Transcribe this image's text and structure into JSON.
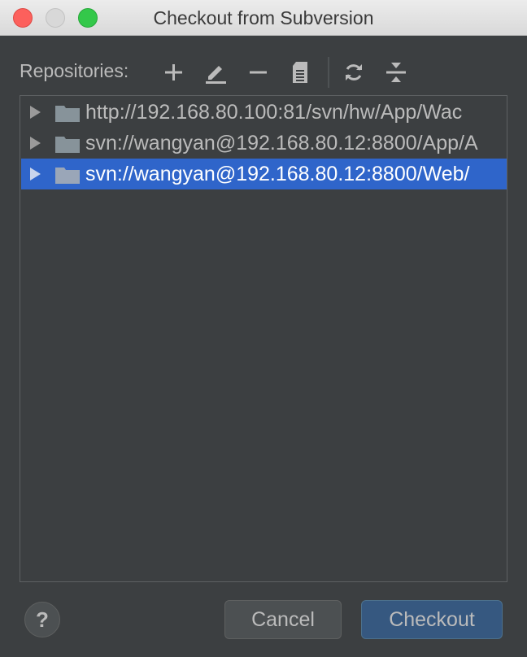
{
  "window": {
    "title": "Checkout from Subversion"
  },
  "toolbar": {
    "label": "Repositories:",
    "icons": [
      "add-icon",
      "edit-icon",
      "remove-icon",
      "browse-changes-icon",
      "refresh-icon",
      "collapse-all-icon"
    ]
  },
  "repositories": [
    {
      "url": "http://192.168.80.100:81/svn/hw/App/Wac",
      "selected": false
    },
    {
      "url": "svn://wangyan@192.168.80.12:8800/App/A",
      "selected": false
    },
    {
      "url": "svn://wangyan@192.168.80.12:8800/Web/",
      "selected": true
    }
  ],
  "footer": {
    "help_label": "?",
    "cancel_label": "Cancel",
    "checkout_label": "Checkout"
  },
  "colors": {
    "background": "#3c3f41",
    "selection": "#2f65ca",
    "default_button": "#365880",
    "text": "#bbbbbb"
  }
}
